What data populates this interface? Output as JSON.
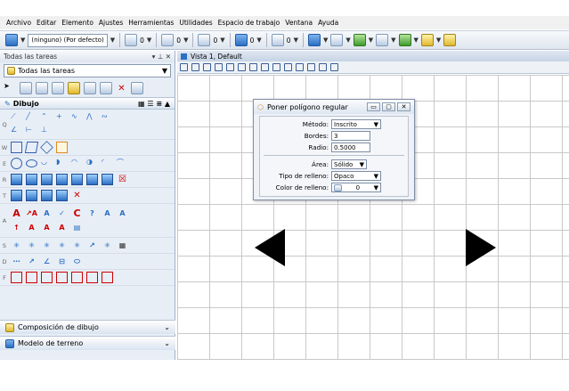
{
  "menu": [
    "Archivo",
    "Editar",
    "Elemento",
    "Ajustes",
    "Herramientas",
    "Utilidades",
    "Espacio de trabajo",
    "Ventana",
    "Ayuda"
  ],
  "toolbar": {
    "level_combo": "(ninguno) (Por defecto)",
    "num1": "0",
    "num2": "0",
    "num3": "0",
    "num4": "0",
    "num5": "0"
  },
  "left_panel": {
    "title": "Todas las tareas",
    "selected_task": "Todas las tareas",
    "section_title": "Dibujo",
    "row_letters": [
      "Q",
      "W",
      "E",
      "R",
      "T",
      "A",
      "S",
      "D",
      "F"
    ],
    "bottom_items": [
      "Composición de dibujo",
      "Modelo de terreno"
    ]
  },
  "view": {
    "title": "Vista 1, Default"
  },
  "dialog": {
    "title": "Poner polígono regular",
    "metodo_label": "Método:",
    "metodo_value": "Inscrito",
    "bordes_label": "Bordes:",
    "bordes_value": "3",
    "radio_label": "Radio:",
    "radio_value": "0.5000",
    "area_label": "Área:",
    "area_value": "Sólido",
    "tipo_label": "Tipo de relleno:",
    "tipo_value": "Opaco",
    "color_label": "Color de relleno:",
    "color_value": "0"
  },
  "colors": {
    "accent": "#2a6fc4",
    "panel_bg": "#e8eef6",
    "grid_line": "#c9c9c9"
  }
}
